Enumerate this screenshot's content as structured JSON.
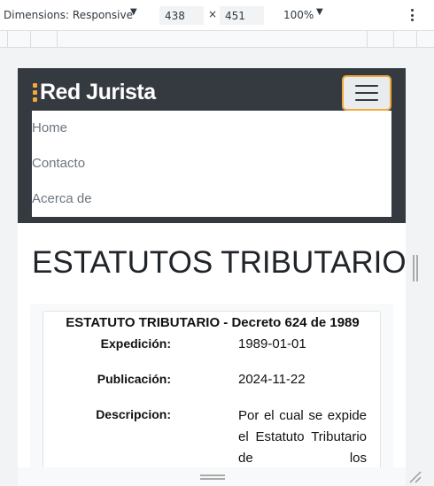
{
  "devtools": {
    "dimensions_label": "Dimensions: Responsive",
    "width": "438",
    "times": "×",
    "height": "451",
    "zoom": "100%"
  },
  "navbar": {
    "brand": "Red Jurista",
    "accent_color": "#f0a93a",
    "background": "#343a40",
    "menu": [
      "Home",
      "Contacto",
      "Acerca de"
    ]
  },
  "page": {
    "title": "ESTATUTOS TRIBUTARIOS"
  },
  "card": {
    "title": "ESTATUTO TRIBUTARIO - Decreto 624 de 1989",
    "fields": [
      {
        "label": "Expedición:",
        "value": "1989-01-01"
      },
      {
        "label": "Publicación:",
        "value": "2024-11-22"
      },
      {
        "label": "Descripcion:",
        "value": "Por el cual se expide el Estatuto Tributario de los"
      }
    ]
  }
}
